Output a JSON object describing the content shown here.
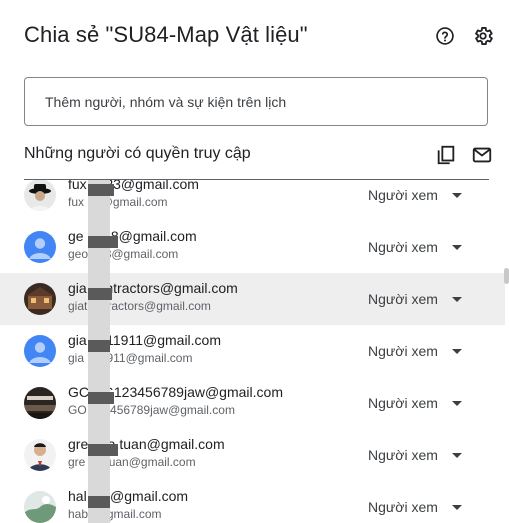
{
  "dialog": {
    "title": "Chia sẻ \"SU84-Map Vật liệu\"",
    "help_icon": "help-circle-icon",
    "settings_icon": "gear-icon"
  },
  "invite": {
    "placeholder": "Thêm người, nhóm và sự kiện trên lịch"
  },
  "access": {
    "heading": "Những người có quyền truy cập",
    "copy_icon": "copy-link-icon",
    "email_icon": "mail-icon"
  },
  "people": [
    {
      "email": "fux k123@gmail.com",
      "sub": "fux 23@gmail.com",
      "role": "Người xem",
      "avatar": "photo-man-hat"
    },
    {
      "email": "ge ne68@gmail.com",
      "sub": "geo e68@gmail.com",
      "role": "Người xem",
      "avatar": "default-person"
    },
    {
      "email": "gia contractors@gmail.com",
      "sub": "giat ontractors@gmail.com",
      "role": "Người xem",
      "avatar": "photo-building"
    },
    {
      "email": "gia on11911@gmail.com",
      "sub": "gia n11911@gmail.com",
      "role": "Người xem",
      "avatar": "default-person"
    },
    {
      "email": "GC NG123456789jaw@gmail.com",
      "sub": "GO 123456789jaw@gmail.com",
      "role": "Người xem",
      "avatar": "photo-interior"
    },
    {
      "email": "gre dea.tuan@gmail.com",
      "sub": "gre ea.tuan@gmail.com",
      "role": "Người xem",
      "avatar": "photo-man-suit"
    },
    {
      "email": "hal ght@gmail.com",
      "sub": "hab t@gmail.com",
      "role": "Người xem",
      "avatar": "photo-landscape"
    }
  ],
  "colors": {
    "accent": "#202124",
    "highlight_row": "#eeeeee",
    "default_avatar": "#4285f4"
  }
}
